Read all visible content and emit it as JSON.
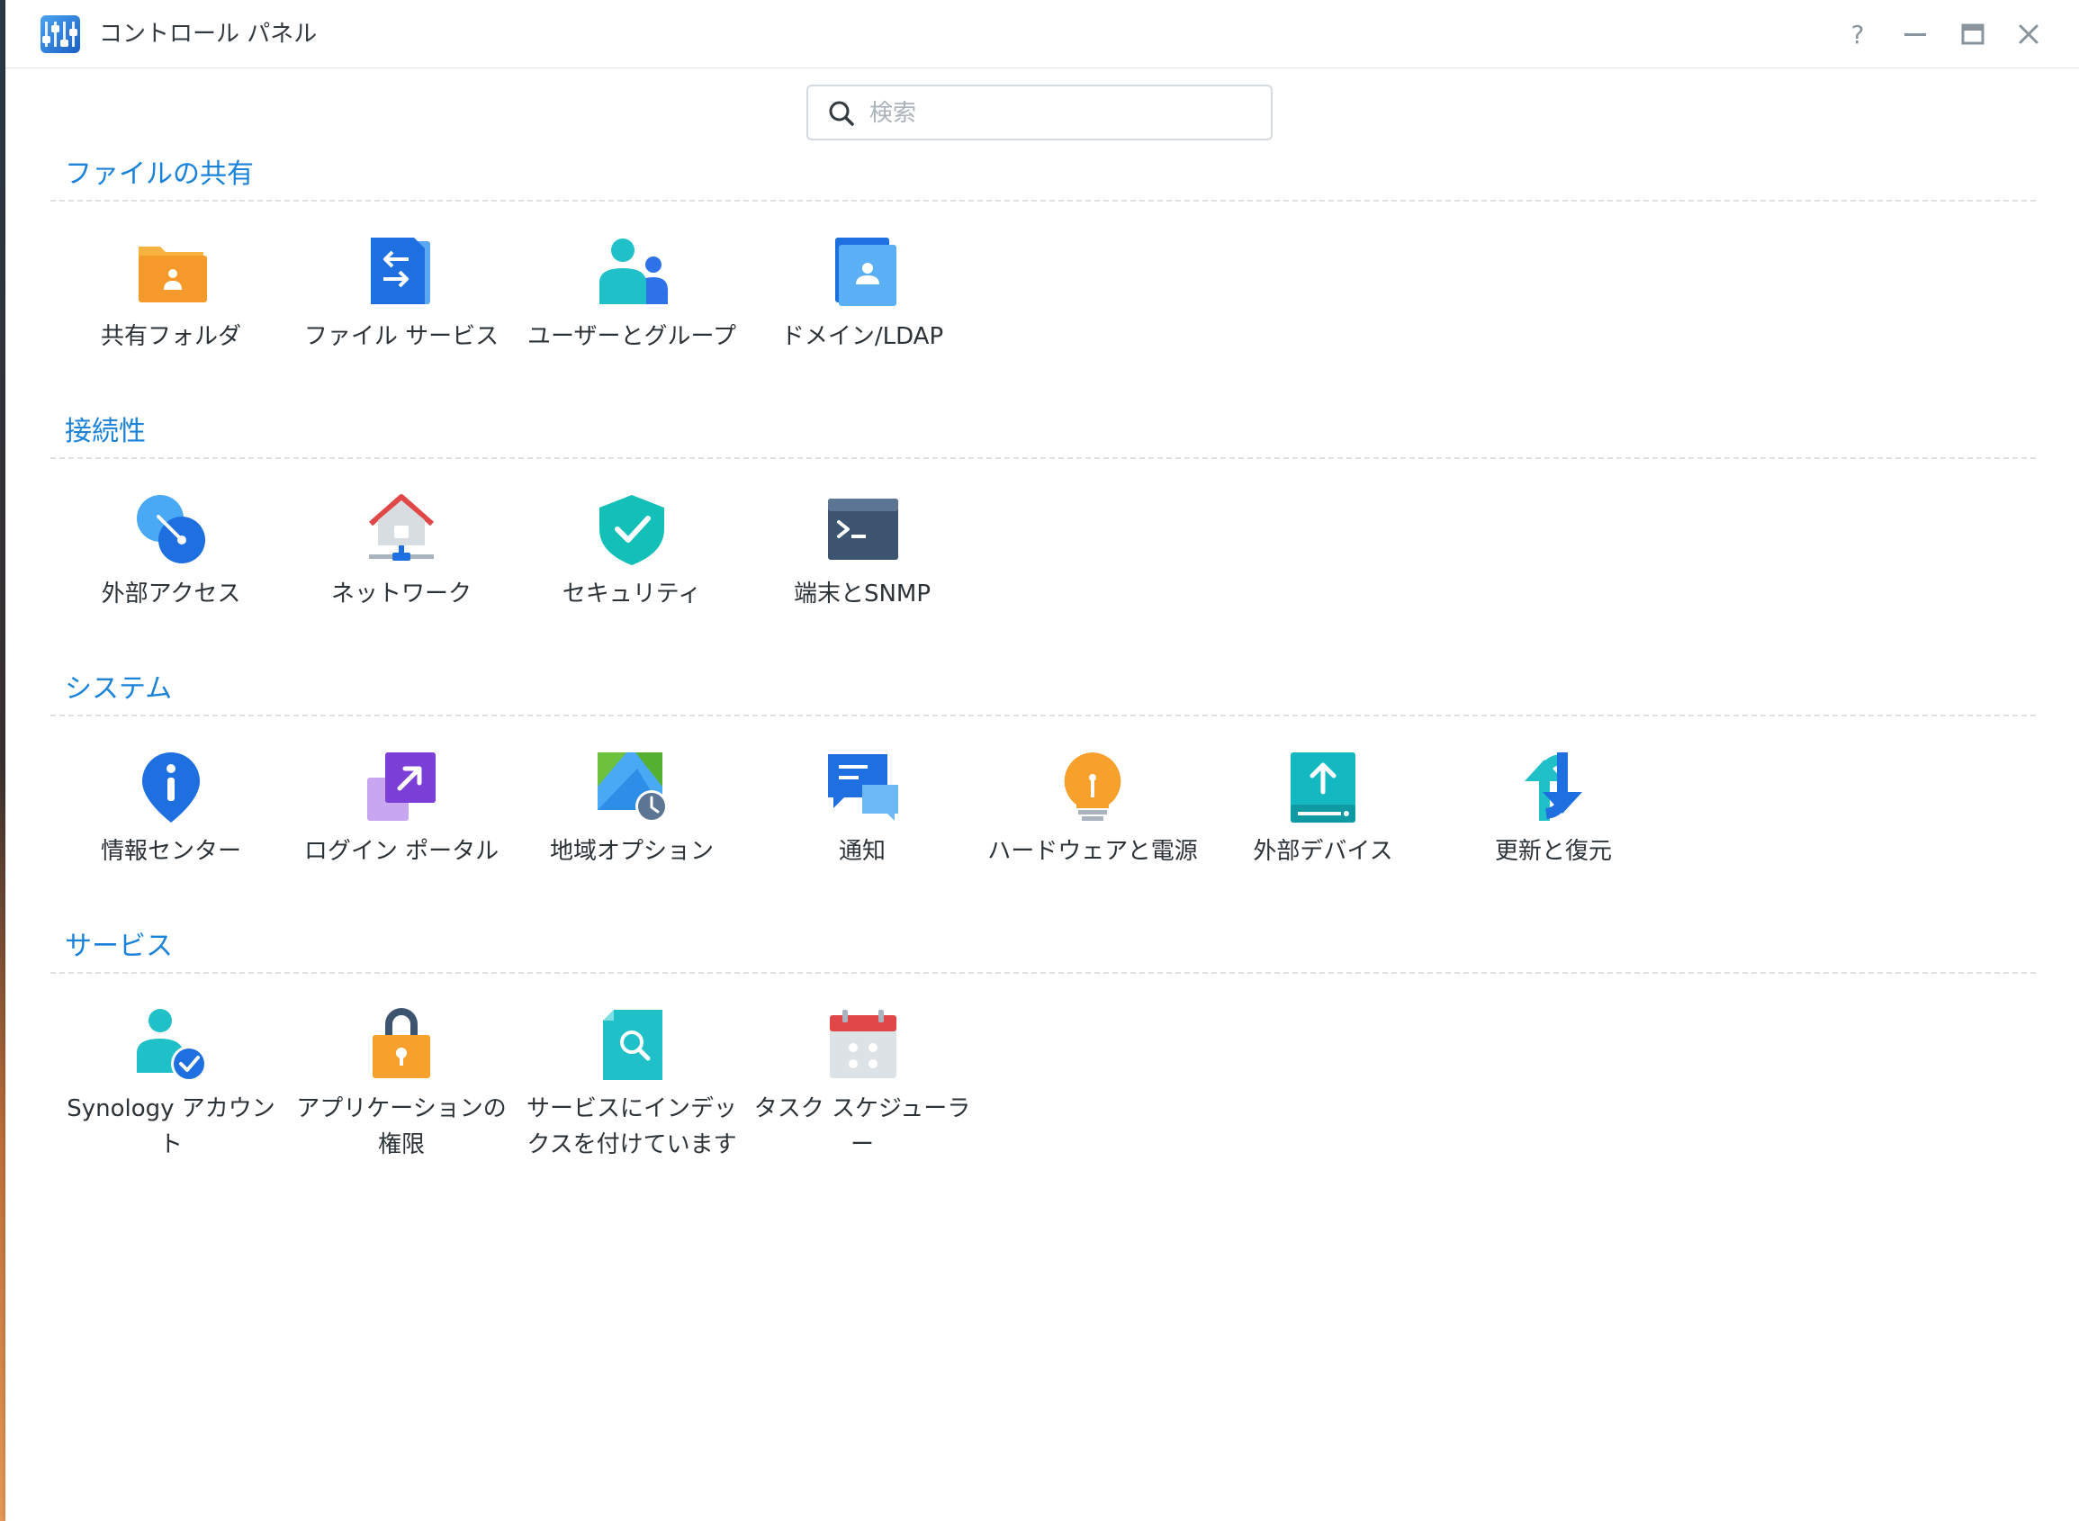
{
  "window": {
    "title": "コントロール パネル",
    "controls": [
      "help-icon",
      "minimize-icon",
      "maximize-icon",
      "close-icon"
    ]
  },
  "search": {
    "placeholder": "検索",
    "value": ""
  },
  "sections": [
    {
      "title": "ファイルの共有",
      "items": [
        {
          "label": "共有フォルダ",
          "icon": "shared-folder-icon"
        },
        {
          "label": "ファイル サービス",
          "icon": "file-services-icon"
        },
        {
          "label": "ユーザーとグループ",
          "icon": "user-group-icon"
        },
        {
          "label": "ドメイン/LDAP",
          "icon": "domain-ldap-icon"
        }
      ]
    },
    {
      "title": "接続性",
      "items": [
        {
          "label": "外部アクセス",
          "icon": "external-access-icon"
        },
        {
          "label": "ネットワーク",
          "icon": "network-icon"
        },
        {
          "label": "セキュリティ",
          "icon": "security-shield-icon"
        },
        {
          "label": "端末とSNMP",
          "icon": "terminal-icon"
        }
      ]
    },
    {
      "title": "システム",
      "items": [
        {
          "label": "情報センター",
          "icon": "info-center-icon"
        },
        {
          "label": "ログイン ポータル",
          "icon": "login-portal-icon"
        },
        {
          "label": "地域オプション",
          "icon": "regional-options-icon"
        },
        {
          "label": "通知",
          "icon": "notification-icon"
        },
        {
          "label": "ハードウェアと電源",
          "icon": "hardware-power-icon"
        },
        {
          "label": "外部デバイス",
          "icon": "external-devices-icon"
        },
        {
          "label": "更新と復元",
          "icon": "update-restore-icon"
        }
      ]
    },
    {
      "title": "サービス",
      "items": [
        {
          "label": "Synology アカウント",
          "icon": "synology-account-icon"
        },
        {
          "label": "アプリケーションの権限",
          "icon": "application-privileges-icon"
        },
        {
          "label": "サービスにインデックスを付けています",
          "icon": "indexing-service-icon"
        },
        {
          "label": "タスク スケジューラー",
          "icon": "task-scheduler-icon"
        }
      ]
    }
  ]
}
